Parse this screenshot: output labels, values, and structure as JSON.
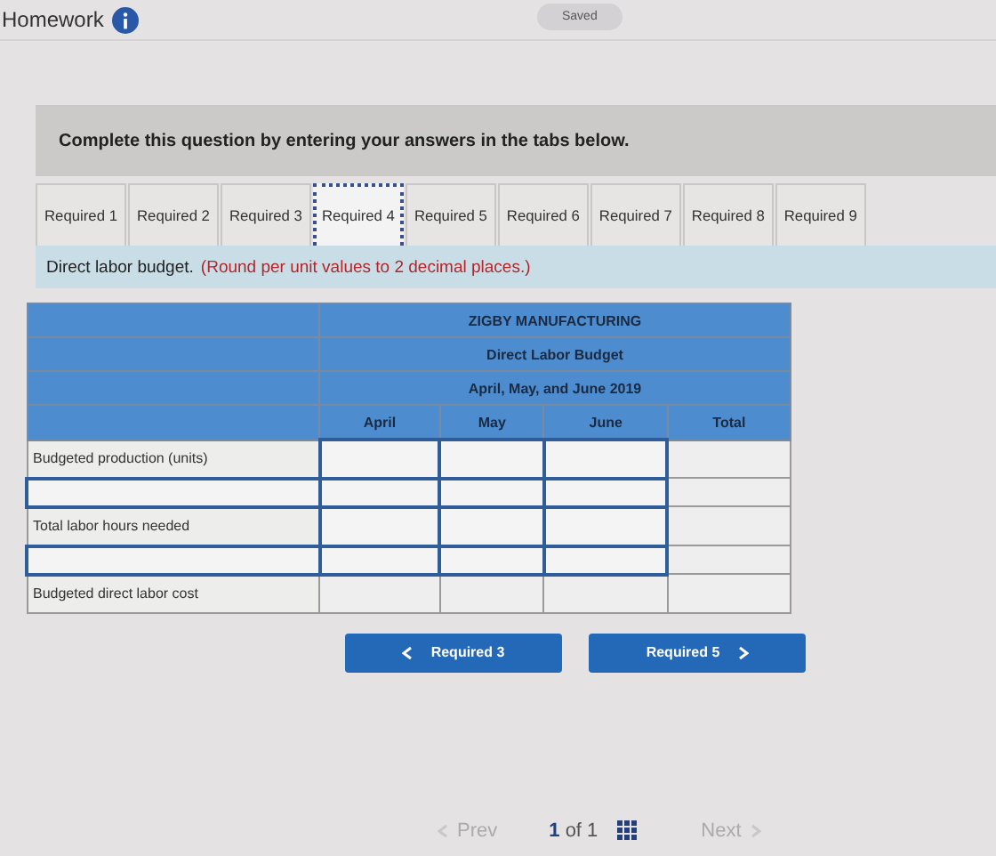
{
  "header": {
    "title": "Homework",
    "status": "Saved"
  },
  "instruction": "Complete this question by entering your answers in the tabs below.",
  "tabs": [
    {
      "label": "Required 1",
      "selected": false
    },
    {
      "label": "Required 2",
      "selected": false
    },
    {
      "label": "Required 3",
      "selected": false
    },
    {
      "label": "Required 4",
      "selected": true
    },
    {
      "label": "Required 5",
      "selected": false
    },
    {
      "label": "Required 6",
      "selected": false
    },
    {
      "label": "Required 7",
      "selected": false
    },
    {
      "label": "Required 8",
      "selected": false
    },
    {
      "label": "Required 9",
      "selected": false
    }
  ],
  "prompt": {
    "text": "Direct labor budget.",
    "note": "(Round per unit values to 2 decimal places.)"
  },
  "table": {
    "titles": [
      "ZIGBY MANUFACTURING",
      "Direct Labor Budget",
      "April, May, and June 2019"
    ],
    "columns": [
      "April",
      "May",
      "June",
      "Total"
    ],
    "rows": [
      {
        "label": {
          "kind": "text",
          "text": "Budgeted production (units)"
        },
        "cells": [
          {
            "kind": "input"
          },
          {
            "kind": "input"
          },
          {
            "kind": "input"
          },
          {
            "kind": "plain"
          }
        ]
      },
      {
        "label": {
          "kind": "input"
        },
        "cells": [
          {
            "kind": "input"
          },
          {
            "kind": "input"
          },
          {
            "kind": "input"
          },
          {
            "kind": "plain"
          }
        ]
      },
      {
        "label": {
          "kind": "text",
          "text": "Total labor hours needed"
        },
        "cells": [
          {
            "kind": "input"
          },
          {
            "kind": "input"
          },
          {
            "kind": "input"
          },
          {
            "kind": "plain"
          }
        ]
      },
      {
        "label": {
          "kind": "input"
        },
        "cells": [
          {
            "kind": "input"
          },
          {
            "kind": "input"
          },
          {
            "kind": "input"
          },
          {
            "kind": "plain"
          }
        ]
      },
      {
        "label": {
          "kind": "text",
          "text": "Budgeted direct labor cost"
        },
        "cells": [
          {
            "kind": "plain"
          },
          {
            "kind": "plain"
          },
          {
            "kind": "plain"
          },
          {
            "kind": "plain"
          }
        ]
      }
    ]
  },
  "nav_buttons": [
    {
      "label": "Required 3",
      "kind": "back"
    },
    {
      "label": "Required 5",
      "kind": "forward"
    }
  ],
  "pager": {
    "prev": {
      "label": "Prev",
      "disabled": true
    },
    "page": "1",
    "of": "of 1",
    "next": {
      "label": "Next",
      "disabled": true
    }
  }
}
